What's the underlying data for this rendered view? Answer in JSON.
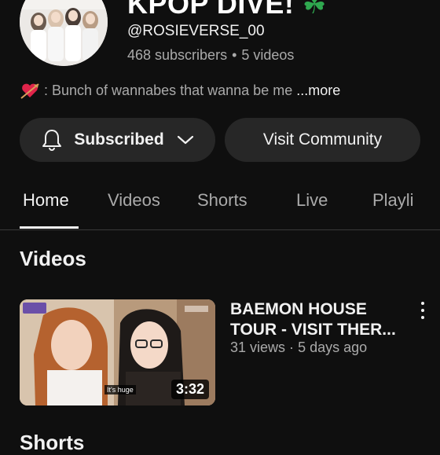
{
  "channel": {
    "title": "KPOP DIVE!",
    "emoji": "☘",
    "handle": "@ROSIEVERSE_00",
    "subscribers": "468 subscribers",
    "separator": "•",
    "videos_count": "5 videos",
    "description": ": Bunch of wannabes that wanna be me",
    "more_label": "...more"
  },
  "buttons": {
    "subscribed_label": "Subscribed",
    "community_label": "Visit Community"
  },
  "tabs": [
    {
      "label": "Home",
      "active": true
    },
    {
      "label": "Videos"
    },
    {
      "label": "Shorts"
    },
    {
      "label": "Live"
    },
    {
      "label": "Playli"
    }
  ],
  "videos_section": {
    "title": "Videos",
    "items": [
      {
        "title": "BAEMON HOUSE TOUR - VISIT THER...",
        "views": "31 views",
        "dot": "·",
        "age": "5 days ago",
        "duration": "3:32",
        "caption": "It's huge"
      }
    ]
  },
  "next_section_title": "Shorts",
  "colors": {
    "background": "#0f0f0f",
    "button": "#272727",
    "text_primary": "#f1f1f1",
    "text_secondary": "#aaaaaa"
  }
}
